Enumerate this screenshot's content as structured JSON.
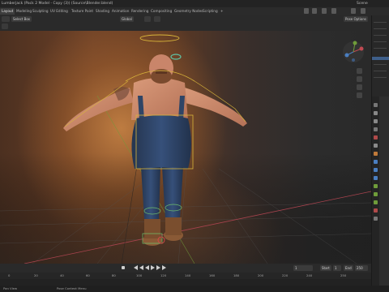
{
  "window": {
    "title": "Lumberjack (Pack 2 Model - Copy (3)) (Source\\Blender.blend)",
    "scene_label": "Scene"
  },
  "workspace_tabs": [
    {
      "label": "Layout",
      "active": true
    },
    {
      "label": "Modeling",
      "active": false
    },
    {
      "label": "Sculpting",
      "active": false
    },
    {
      "label": "UV Editing",
      "active": false
    },
    {
      "label": "Texture Paint",
      "active": false
    },
    {
      "label": "Shading",
      "active": false
    },
    {
      "label": "Animation",
      "active": false
    },
    {
      "label": "Rendering",
      "active": false
    },
    {
      "label": "Compositing",
      "active": false
    },
    {
      "label": "Geometry Nodes",
      "active": false
    },
    {
      "label": "Scripting",
      "active": false
    },
    {
      "label": "+",
      "active": false
    }
  ],
  "viewport_header": {
    "select_box": "Select Box",
    "transform_orientation": "Global",
    "pose_options": "Pose Options"
  },
  "timeline": {
    "current_frame": "1",
    "start_label": "Start",
    "start_value": "1",
    "end_label": "End",
    "end_value": "250",
    "ruler_ticks": [
      "0",
      "20",
      "40",
      "60",
      "80",
      "100",
      "120",
      "140",
      "160",
      "180",
      "200",
      "220",
      "240",
      "250"
    ]
  },
  "status_bar": {
    "left": "Pan View",
    "middle": "Pose Context Menu"
  },
  "colors": {
    "accent": "#3e5f8a",
    "bone_selection": "#d8b43a",
    "axis_x": "#a8434e",
    "axis_y": "#6f9c3a"
  }
}
